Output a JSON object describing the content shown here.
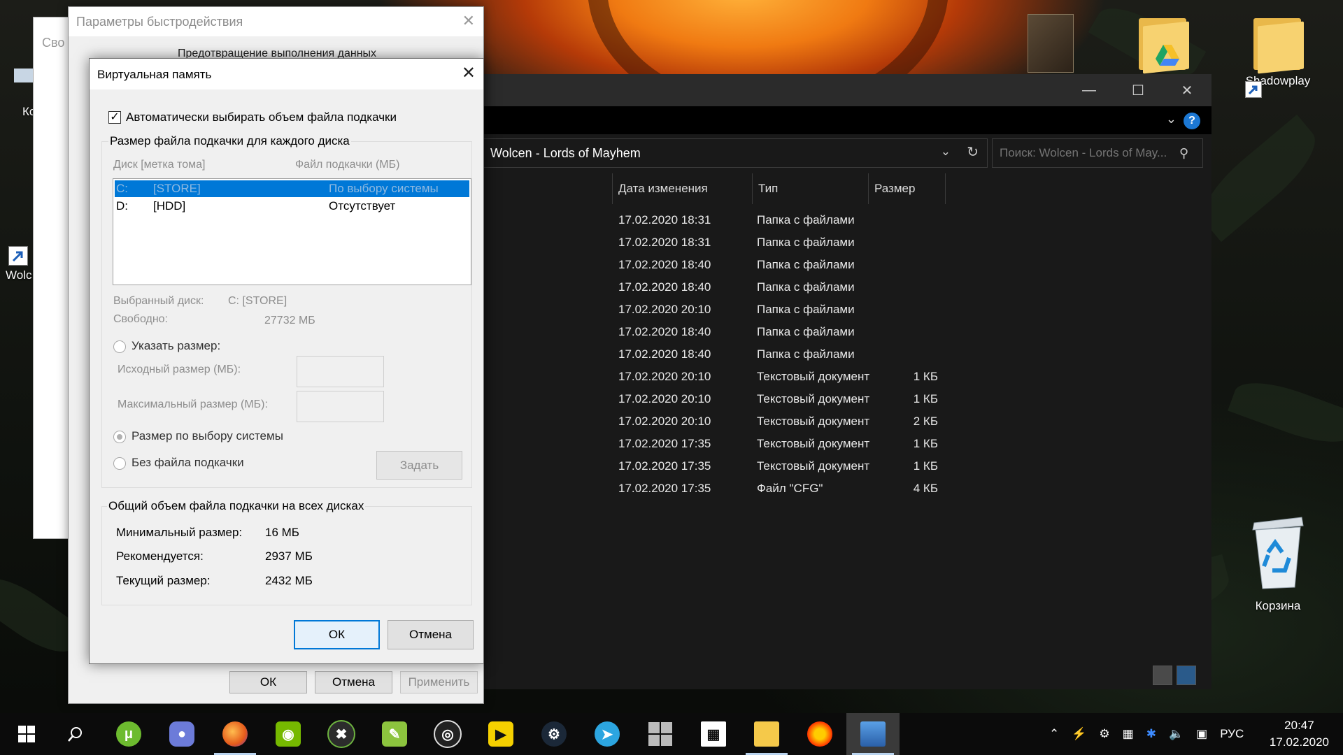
{
  "desktop": {
    "icons": [
      {
        "label": "Shadowplay"
      },
      {
        "label": "Корзина"
      }
    ],
    "partial_labels": [
      "Ко",
      "Wolc"
    ]
  },
  "explorer": {
    "path": "Wolcen - Lords of Mayhem",
    "search_placeholder": "Поиск: Wolcen - Lords of May...",
    "columns": [
      "Дата изменения",
      "Тип",
      "Размер"
    ],
    "rows": [
      {
        "date": "17.02.2020 18:31",
        "type": "Папка с файлами",
        "size": ""
      },
      {
        "date": "17.02.2020 18:31",
        "type": "Папка с файлами",
        "size": ""
      },
      {
        "date": "17.02.2020 18:40",
        "type": "Папка с файлами",
        "size": ""
      },
      {
        "date": "17.02.2020 18:40",
        "type": "Папка с файлами",
        "size": ""
      },
      {
        "date": "17.02.2020 20:10",
        "type": "Папка с файлами",
        "size": ""
      },
      {
        "date": "17.02.2020 18:40",
        "type": "Папка с файлами",
        "size": ""
      },
      {
        "date": "17.02.2020 18:40",
        "type": "Папка с файлами",
        "size": ""
      },
      {
        "date": "17.02.2020 20:10",
        "type": "Текстовый документ",
        "size": "1 КБ"
      },
      {
        "date": "17.02.2020 20:10",
        "type": "Текстовый документ",
        "size": "1 КБ"
      },
      {
        "date": "17.02.2020 20:10",
        "type": "Текстовый документ",
        "size": "2 КБ"
      },
      {
        "date": "17.02.2020 17:35",
        "type": "Текстовый документ",
        "size": "1 КБ"
      },
      {
        "date": "17.02.2020 17:35",
        "type": "Текстовый документ",
        "size": "1 КБ"
      },
      {
        "date": "17.02.2020 17:35",
        "type": "Файл \"CFG\"",
        "size": "4 КБ"
      }
    ]
  },
  "sysprops": {
    "title_partial": "Сво"
  },
  "perf": {
    "title": "Параметры быстродействия",
    "tab": "Предотвращение выполнения данных",
    "ok": "ОК",
    "cancel": "Отмена",
    "apply": "Применить"
  },
  "vm": {
    "title": "Виртуальная память",
    "auto_label": "Автоматически выбирать объем файла подкачки",
    "auto_checked": true,
    "per_disk_group": "Размер файла подкачки для каждого диска",
    "col_disk": "Диск [метка тома]",
    "col_pagefile": "Файл подкачки (МБ)",
    "drives": [
      {
        "letter": "C:",
        "label": "[STORE]",
        "pagefile": "По выбору системы",
        "selected": true
      },
      {
        "letter": "D:",
        "label": "[HDD]",
        "pagefile": "Отсутствует",
        "selected": false
      }
    ],
    "selected_disk_label": "Выбранный диск:",
    "selected_disk_value": "C:  [STORE]",
    "free_label": "Свободно:",
    "free_value": "27732 МБ",
    "custom_size": "Указать размер:",
    "initial_size": "Исходный размер (МБ):",
    "max_size": "Максимальный размер (МБ):",
    "system_managed": "Размер по выбору системы",
    "no_paging": "Без файла подкачки",
    "set_button": "Задать",
    "total_group": "Общий объем файла подкачки на всех дисках",
    "min_label": "Минимальный размер:",
    "min_value": "16 МБ",
    "rec_label": "Рекомендуется:",
    "rec_value": "2937 МБ",
    "cur_label": "Текущий размер:",
    "cur_value": "2432 МБ",
    "ok": "ОК",
    "cancel": "Отмена"
  },
  "taskbar": {
    "language": "РУС",
    "time": "20:47",
    "date": "17.02.2020"
  },
  "colors": {
    "accent": "#0078d7",
    "explorer_bg": "#191919",
    "taskbar_bg": "#0b0b0b"
  }
}
